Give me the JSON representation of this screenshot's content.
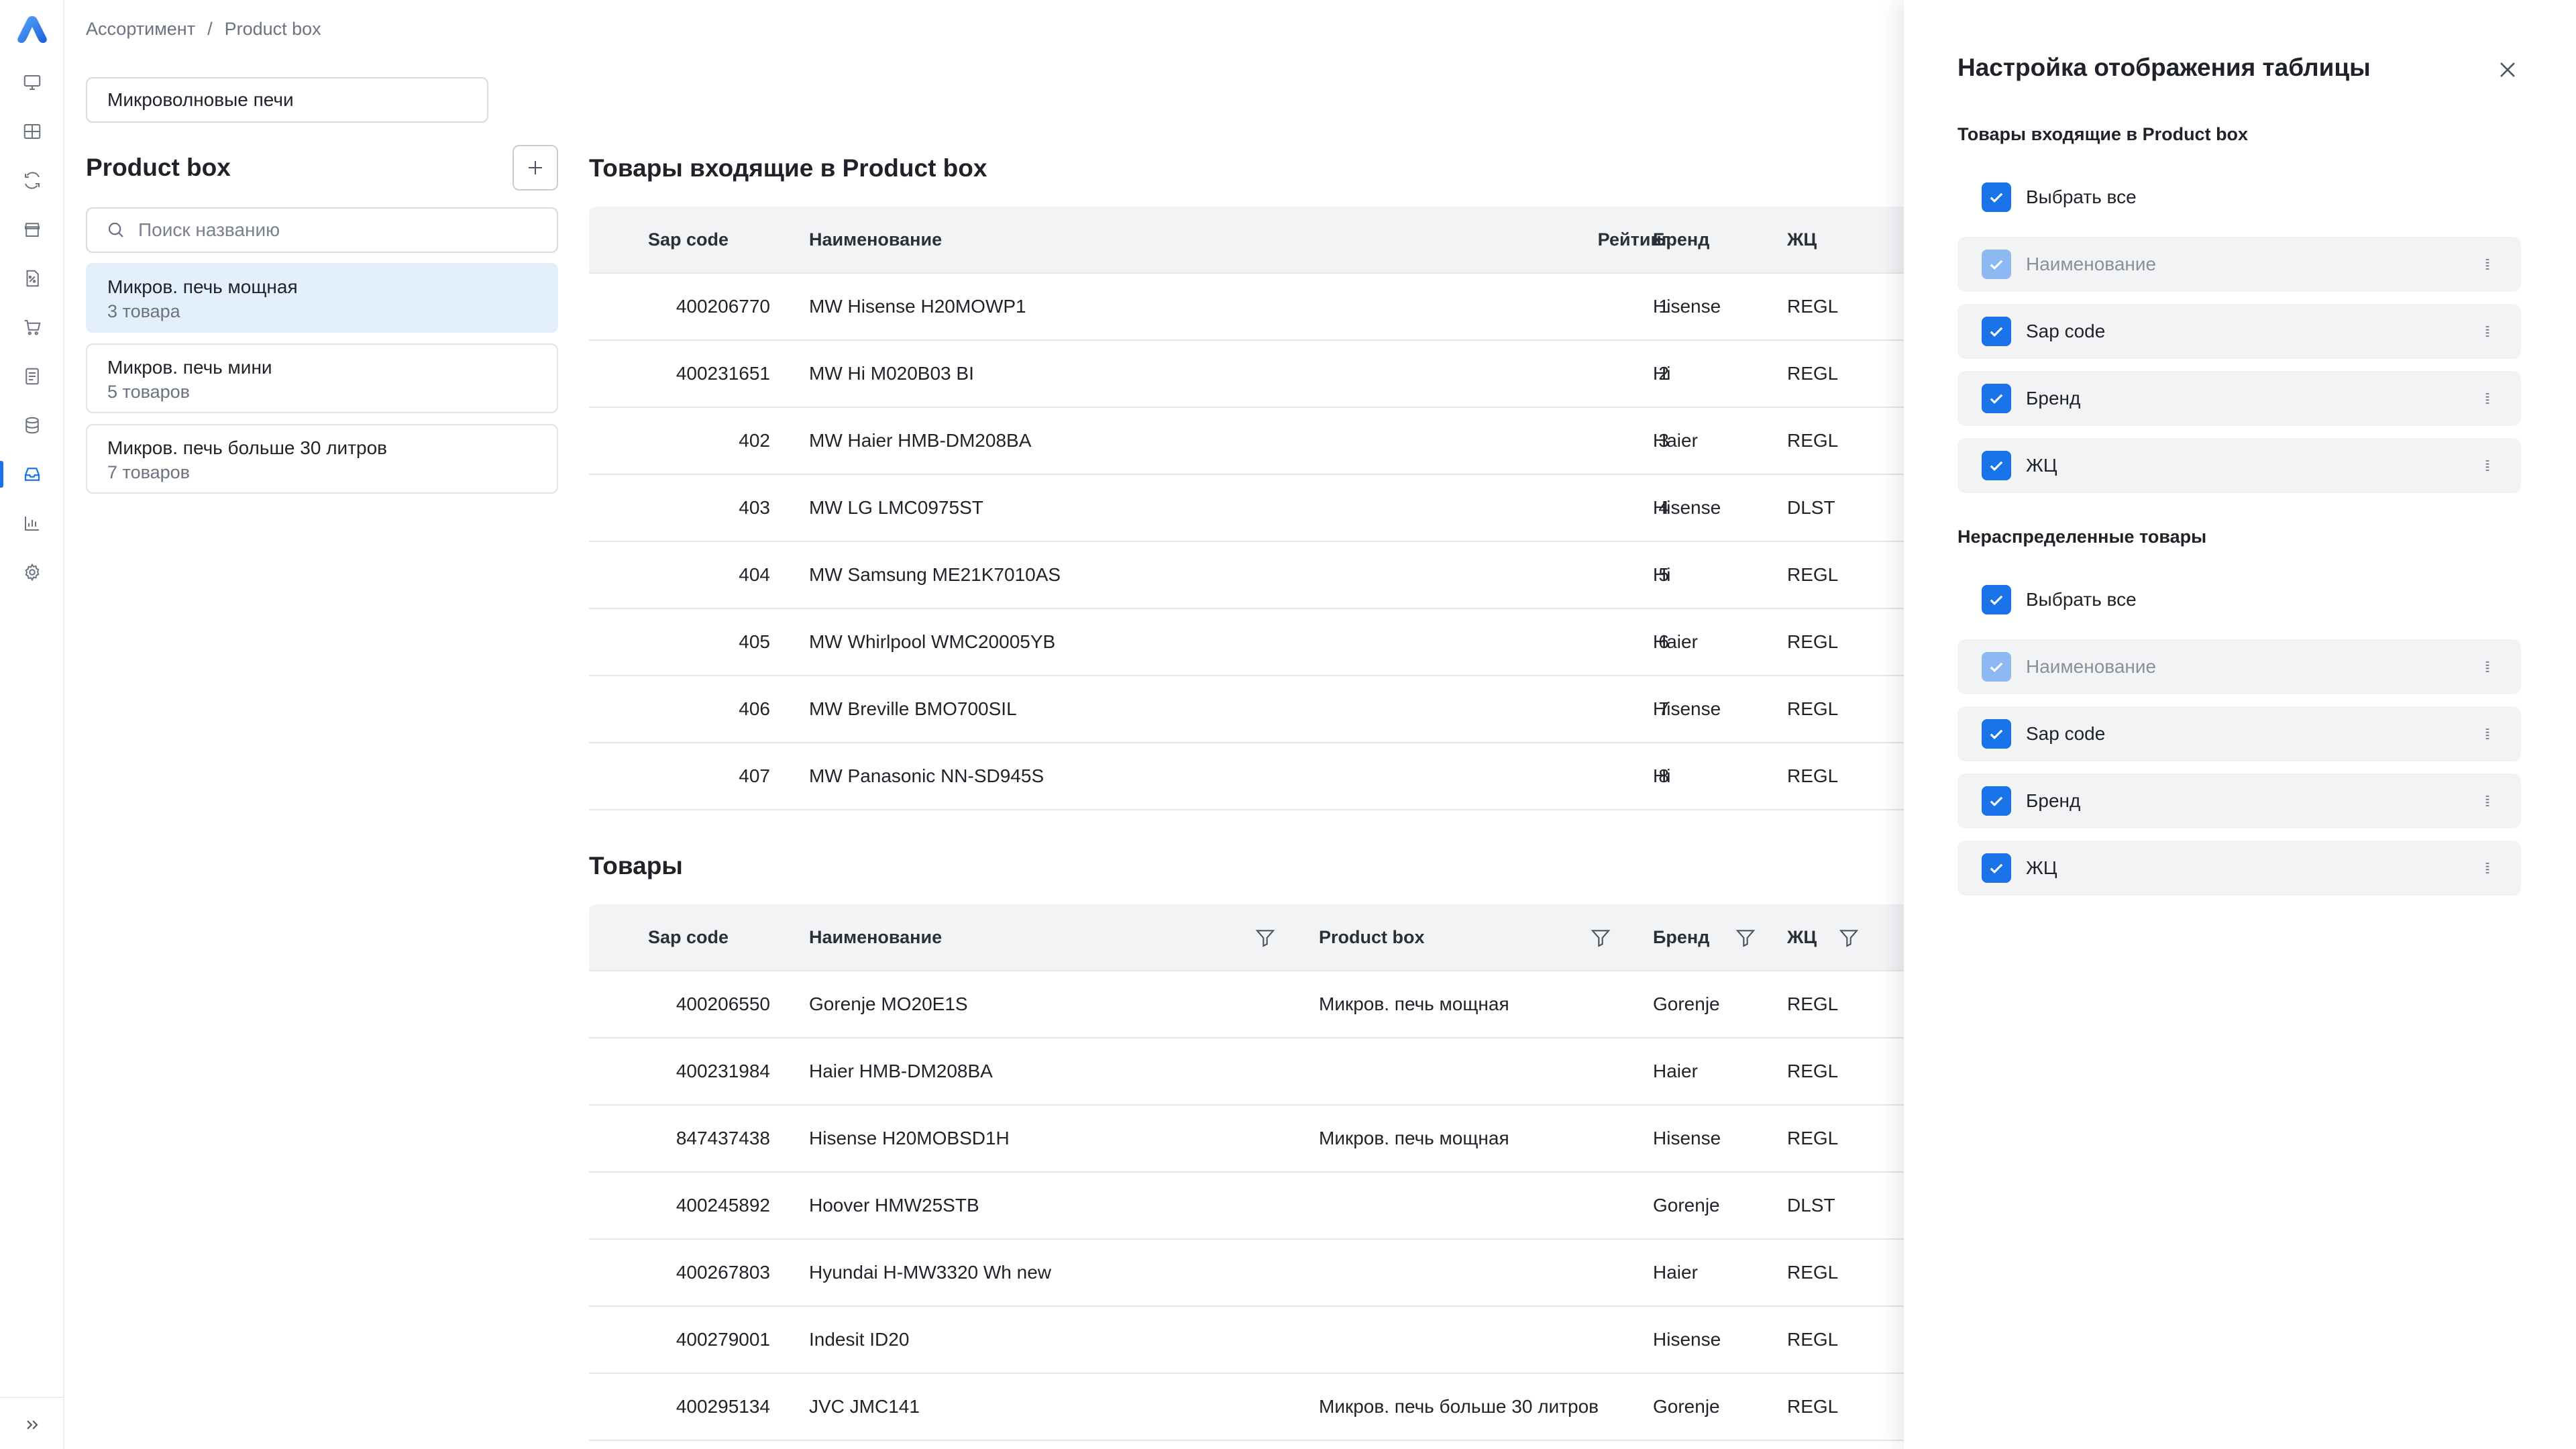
{
  "colors": {
    "accent": "#1a73e8",
    "selected_bg": "#e3effd",
    "header_bg": "#f2f3f5"
  },
  "rail": {
    "items": [
      "monitor-icon",
      "grid-icon",
      "refresh-icon",
      "store-icon",
      "percent-doc-icon",
      "cart-icon",
      "document-list-icon",
      "database-icon",
      "inbox-icon",
      "bar-chart-icon",
      "gear-icon"
    ],
    "active": "inbox-icon"
  },
  "breadcrumb": {
    "item1": "Ассортимент",
    "sep": "/",
    "item2": "Product box"
  },
  "category_select": {
    "value": "Микроволновые печи"
  },
  "product_box": {
    "title": "Product box",
    "search_placeholder": "Поиск названию",
    "items": [
      {
        "name": "Микров. печь мощная",
        "count": "3 товара"
      },
      {
        "name": "Микров. печь мини",
        "count": "5 товаров"
      },
      {
        "name": "Микров. печь больше 30 литров",
        "count": "7 товаров"
      }
    ]
  },
  "included_table": {
    "title": "Товары входящие в Product box",
    "columns": {
      "sap": "Sap code",
      "name": "Наименование",
      "rating": "Рейтинг",
      "brand": "Бренд",
      "lc": "ЖЦ"
    },
    "rows": [
      {
        "sap": "400206770",
        "name": "MW Hisense H20MOWP1",
        "rating": "1",
        "brand": "Hisense",
        "lc": "REGL"
      },
      {
        "sap": "400231651",
        "name": "MW Hi M020B03 BI",
        "rating": "2",
        "brand": "Hi",
        "lc": "REGL"
      },
      {
        "sap": "402",
        "name": "MW Haier HMB-DM208BA",
        "rating": "3",
        "brand": "Haier",
        "lc": "REGL"
      },
      {
        "sap": "403",
        "name": "MW LG LMC0975ST",
        "rating": "4",
        "brand": "Hisense",
        "lc": "DLST"
      },
      {
        "sap": "404",
        "name": "MW Samsung ME21K7010AS",
        "rating": "5",
        "brand": "Hi",
        "lc": "REGL"
      },
      {
        "sap": "405",
        "name": "MW Whirlpool WMC20005YB",
        "rating": "6",
        "brand": "Haier",
        "lc": "REGL"
      },
      {
        "sap": "406",
        "name": "MW Breville BMO700SIL",
        "rating": "7",
        "brand": "Hisense",
        "lc": "REGL"
      },
      {
        "sap": "407",
        "name": "MW Panasonic NN-SD945S",
        "rating": "8",
        "brand": "Hi",
        "lc": "REGL"
      }
    ]
  },
  "goods_table": {
    "title": "Товары",
    "columns": {
      "sap": "Sap code",
      "name": "Наименование",
      "pbox": "Product box",
      "brand": "Бренд",
      "lc": "ЖЦ"
    },
    "rows": [
      {
        "sap": "400206550",
        "name": "Gorenje MO20E1S",
        "pbox": "Микров. печь мощная",
        "brand": "Gorenje",
        "lc": "REGL"
      },
      {
        "sap": "400231984",
        "name": "Haier HMB-DM208BA",
        "pbox": "",
        "brand": "Haier",
        "lc": "REGL"
      },
      {
        "sap": "847437438",
        "name": "Hisense H20MOBSD1H",
        "pbox": "Микров. печь мощная",
        "brand": "Hisense",
        "lc": "REGL"
      },
      {
        "sap": "400245892",
        "name": "Hoover HMW25STB",
        "pbox": "",
        "brand": "Gorenje",
        "lc": "DLST"
      },
      {
        "sap": "400267803",
        "name": "Hyundai H-MW3320 Wh new",
        "pbox": "",
        "brand": "Haier",
        "lc": "REGL"
      },
      {
        "sap": "400279001",
        "name": "Indesit ID20",
        "pbox": "",
        "brand": "Hisense",
        "lc": "REGL"
      },
      {
        "sap": "400295134",
        "name": "JVC JMC141",
        "pbox": "Микров. печь больше 30 литров",
        "brand": "Gorenje",
        "lc": "REGL"
      }
    ]
  },
  "drawer": {
    "title": "Настройка отображения таблицы",
    "section1": {
      "title": "Товары входящие в Product box",
      "select_all": "Выбрать все",
      "items": [
        "Наименование",
        "Sap code",
        "Бренд",
        "ЖЦ"
      ]
    },
    "section2": {
      "title": "Нераспределенные товары",
      "select_all": "Выбрать все",
      "items": [
        "Наименование",
        "Sap code",
        "Бренд",
        "ЖЦ"
      ]
    }
  }
}
